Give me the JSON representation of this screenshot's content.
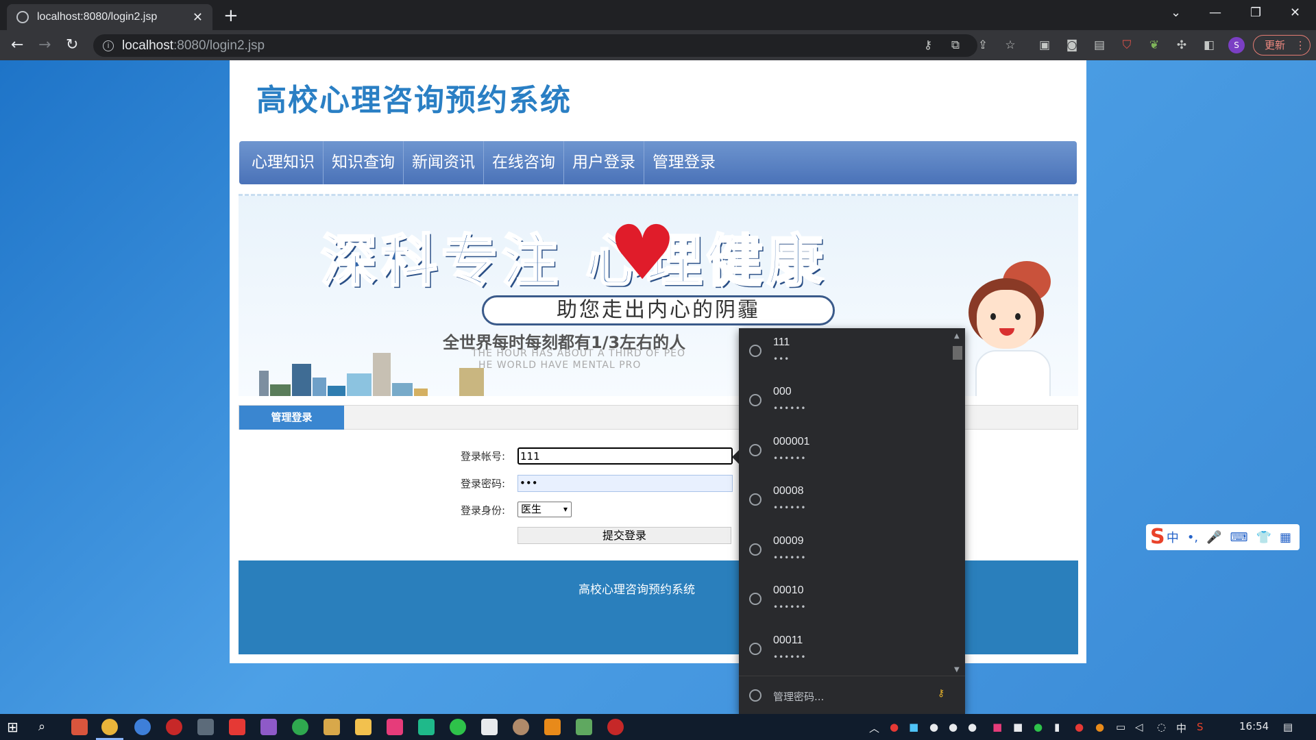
{
  "browser": {
    "tab_title": "localhost:8080/login2.jsp",
    "tab_close": "✕",
    "new_tab": "+",
    "url_host": "localhost",
    "url_rest": ":8080/login2.jsp",
    "update_label": "更新",
    "avatar_letter": "S"
  },
  "site": {
    "title": "高校心理咨询预约系统",
    "nav": [
      "心理知识",
      "知识查询",
      "新闻资讯",
      "在线咨询",
      "用户登录",
      "管理登录"
    ]
  },
  "banner": {
    "headline": "深科专注  心理健康",
    "subtitle": "助您走出内心的阴霾",
    "line": "全世界每时每刻都有1/3左右的人",
    "en_line1": "THE HOUR HAS ABOUT A THIRD OF PEO",
    "en_line2": "HE WORLD HAVE MENTAL PRO"
  },
  "login": {
    "tab_label": "管理登录",
    "account_label": "登录帐号:",
    "account_value": "111",
    "password_label": "登录密码:",
    "password_value": "•••",
    "role_label": "登录身份:",
    "role_value": "医生",
    "submit_label": "提交登录"
  },
  "footer": {
    "text": "高校心理咨询预约系统"
  },
  "autofill": {
    "entries": [
      {
        "user": "111",
        "pass": "•••"
      },
      {
        "user": "000",
        "pass": "••••••"
      },
      {
        "user": "000001",
        "pass": "••••••"
      },
      {
        "user": "00008",
        "pass": "••••••"
      },
      {
        "user": "00009",
        "pass": "••••••"
      },
      {
        "user": "00010",
        "pass": "••••••"
      },
      {
        "user": "00011",
        "pass": "••••••"
      }
    ],
    "manage_label": "管理密码..."
  },
  "ime": {
    "items": [
      "中",
      "•,",
      "🎤",
      "⌨",
      "👕",
      "▦"
    ]
  },
  "taskbar": {
    "clock": "16:54"
  },
  "colors": {
    "nav_bg": "#4a72b8",
    "title_blue": "#2a7fc4",
    "footer_bg": "#2a7fbc",
    "login_tab": "#3a86d0"
  }
}
